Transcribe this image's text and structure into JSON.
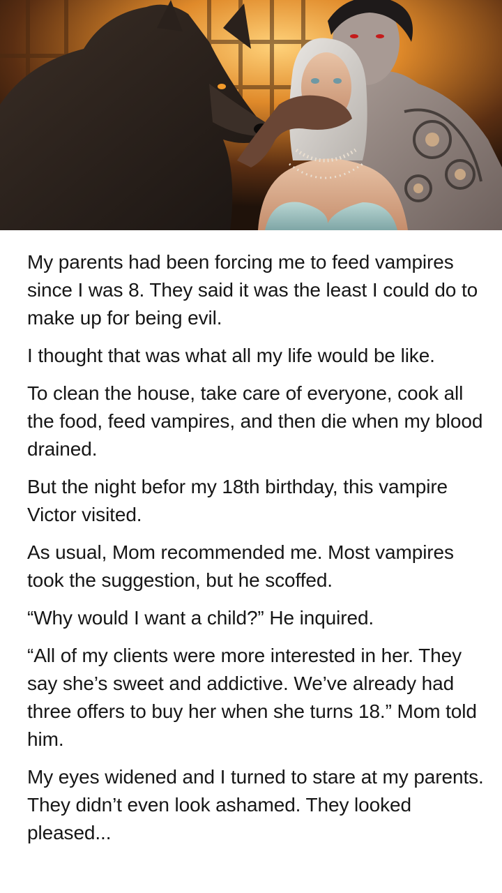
{
  "hero_image": {
    "subject": "werewolf, silver-haired woman and vampire illustration"
  },
  "story": {
    "paragraphs": [
      "My parents had been forcing me to feed vampires since I was 8. They said it was the least I could do to make up for being evil.",
      "I thought that was what all my life would be like.",
      "To clean the house, take care of everyone, cook all the food, feed vampires, and then die when my blood drained.",
      "But the night befor my 18th birthday, this vampire Victor visited.",
      "As usual, Mom recommended me. Most vampires took the suggestion, but he scoffed.",
      "“Why would I want a child?” He inquired.",
      "“All of my clients were more interested in her. They say she’s sweet and addictive. We’ve already had three offers to buy her when she turns 18.” Mom told him.",
      "My eyes widened and I turned to stare at my parents. They didn’t even look ashamed. They looked pleased..."
    ]
  },
  "colors": {
    "text": "#161616",
    "background": "#ffffff",
    "glow": "#f2a23a"
  }
}
